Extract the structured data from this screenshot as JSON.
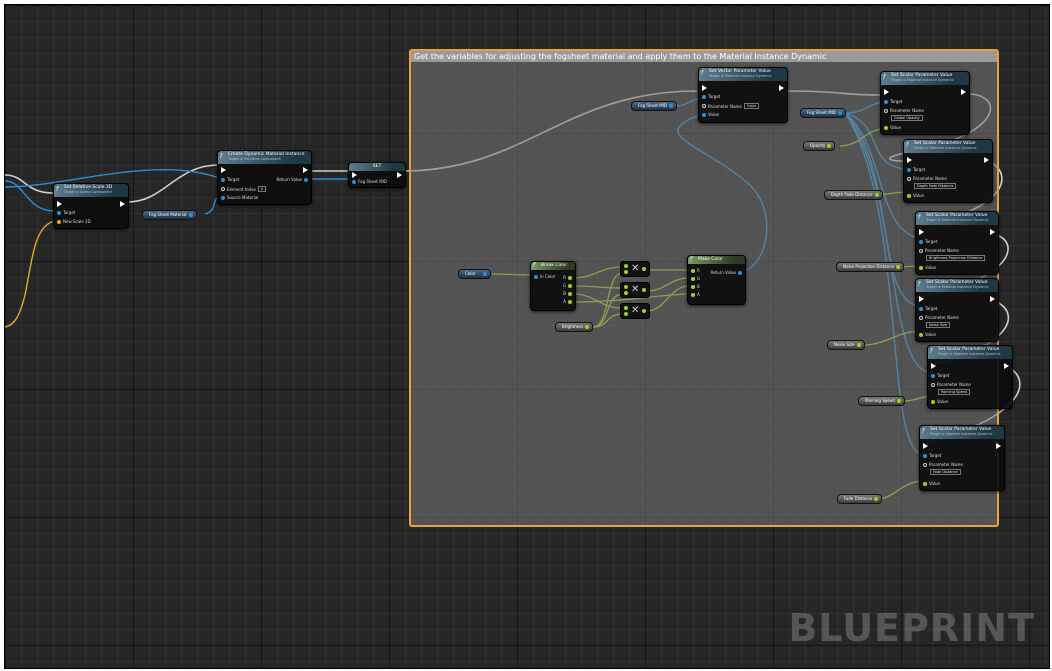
{
  "comment": {
    "title": "Get the variables for adjusting the fogsheet material and apply them to the Material Instance Dynamic"
  },
  "watermark": "BLUEPRINT",
  "colors": {
    "comment_border": "#e7a23c",
    "object_pin": "#2b8fd6",
    "float_pin": "#9bd420",
    "vector_pin": "#e2a82f",
    "grid_bg": "#262626"
  },
  "labels": {
    "target": "Target",
    "param_name": "Parameter Name",
    "value": "Value",
    "return_value": "Return Value"
  },
  "nodes": {
    "relative_scale": {
      "title": "Set Relative Scale 3D",
      "subtitle": "Target is Scene Component",
      "target": "Target",
      "new_scale": "New Scale 3D"
    },
    "create_mid": {
      "title": "Create Dynamic Material Instance",
      "subtitle": "Target is Primitive Component",
      "target": "Target",
      "element_index": "Element Index",
      "element_value": "0",
      "source_material": "Source Material",
      "return_value": "Return Value"
    },
    "set_var": {
      "title": "SET",
      "pin": "Fog Sheet MID"
    },
    "set_vector": {
      "title": "Set Vector Parameter Value",
      "subtitle": "Target is Material Instance Dynamic",
      "param_value": "Color"
    },
    "break_color": {
      "title": "Break Color",
      "in": "In Color",
      "pins": [
        "R",
        "G",
        "B",
        "A"
      ]
    },
    "make_color": {
      "title": "Make Color",
      "pins": [
        "R",
        "G",
        "B",
        "A"
      ],
      "out": "Return Value"
    },
    "scalar_nodes": [
      {
        "title": "Set Scalar Parameter Value",
        "subtitle": "Target is Material Instance Dynamic",
        "param": "Global Opacity"
      },
      {
        "title": "Set Scalar Parameter Value",
        "subtitle": "Target is Material Instance Dynamic",
        "param": "Depth Fade Distance"
      },
      {
        "title": "Set Scalar Parameter Value",
        "subtitle": "Target is Material Instance Dynamic",
        "param": "Brightness Projection Distance"
      },
      {
        "title": "Set Scalar Parameter Value",
        "subtitle": "Target is Material Instance Dynamic",
        "param": "Noise Size"
      },
      {
        "title": "Set Scalar Parameter Value",
        "subtitle": "Target is Material Instance Dynamic",
        "param": "Panning Speed"
      },
      {
        "title": "Set Scalar Parameter Value",
        "subtitle": "Target is Material Instance Dynamic",
        "param": "Fade Distance"
      }
    ]
  },
  "variables": {
    "fog_sheet_material": "Fog Sheet Material",
    "fog_sheet_mid_a": "Fog Sheet MID",
    "fog_sheet_mid_b": "Fog Sheet MID",
    "color": "Color",
    "brightness": "Brightness",
    "opacity": "Opacity",
    "depth_fade": "Depth Fade Distance",
    "noise_projection": "Noise Projection Distance",
    "noise_size": "Noise Size",
    "panning_speed": "Panning Speed",
    "fade_distance": "Fade Distance"
  }
}
